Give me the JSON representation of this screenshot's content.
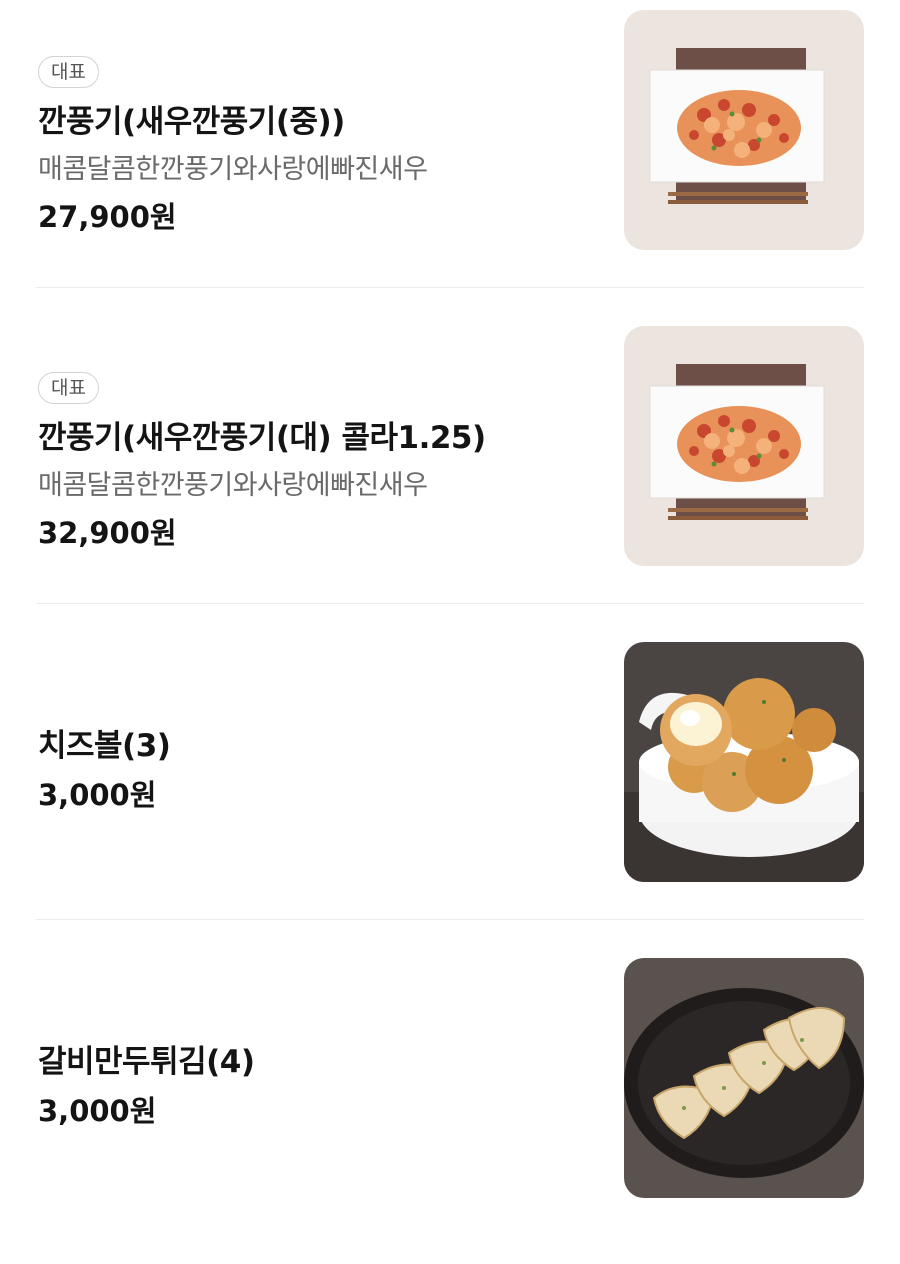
{
  "menu": {
    "items": [
      {
        "badge": "대표",
        "name": "깐풍기(새우깐풍기(중))",
        "description": "매콤달콤한깐풍기와사랑에빠진새우",
        "price": "27,900원",
        "image_icon": "shrimp-kkanpunggi-photo"
      },
      {
        "badge": "대표",
        "name": "깐풍기(새우깐풍기(대) 콜라1.25)",
        "description": "매콤달콤한깐풍기와사랑에빠진새우",
        "price": "32,900원",
        "image_icon": "shrimp-kkanpunggi-photo"
      },
      {
        "name": "치즈볼(3)",
        "price": "3,000원",
        "image_icon": "cheese-ball-photo"
      },
      {
        "name": "갈비만두튀김(4)",
        "price": "3,000원",
        "image_icon": "fried-dumpling-photo"
      }
    ]
  },
  "colors": {
    "background": "#ffffff",
    "divider": "#ececec",
    "title_text": "#141414",
    "description_text": "#6a6a6a",
    "badge_border": "#d4d4d4"
  }
}
